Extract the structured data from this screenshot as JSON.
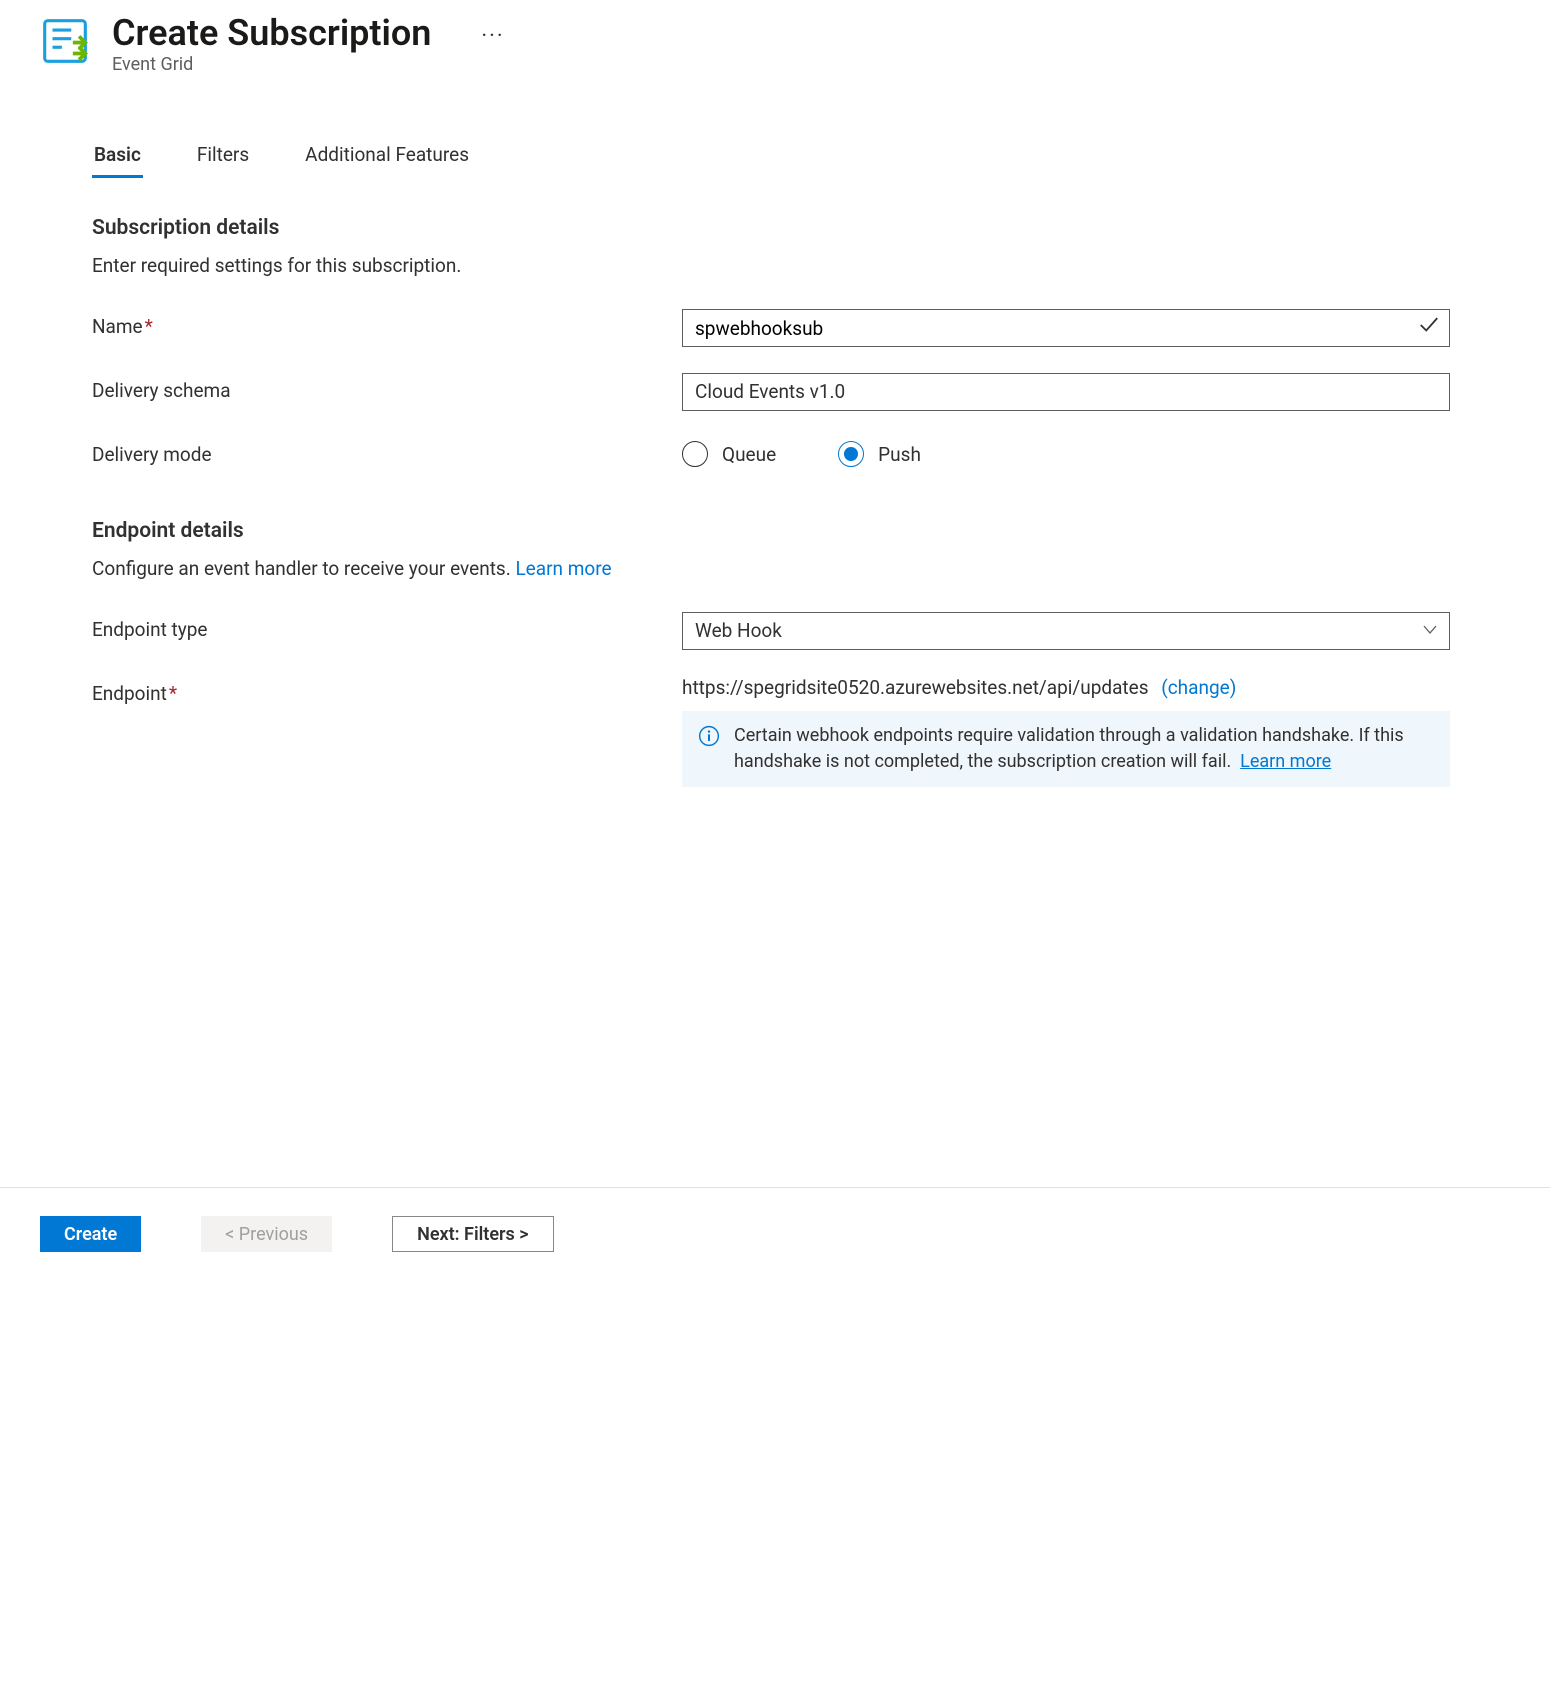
{
  "header": {
    "title": "Create Subscription",
    "subtitle": "Event Grid"
  },
  "tabs": {
    "items": [
      {
        "label": "Basic"
      },
      {
        "label": "Filters"
      },
      {
        "label": "Additional Features"
      }
    ]
  },
  "form": {
    "subscription": {
      "section_title": "Subscription details",
      "section_desc": "Enter required settings for this subscription.",
      "name_label": "Name",
      "name_value": "spwebhooksub",
      "schema_label": "Delivery schema",
      "schema_value": "Cloud Events v1.0",
      "mode_label": "Delivery mode",
      "mode_queue": "Queue",
      "mode_push": "Push"
    },
    "endpoint": {
      "section_title": "Endpoint details",
      "section_desc": "Configure an event handler to receive your events.",
      "learn_more": "Learn more",
      "type_label": "Endpoint type",
      "type_value": "Web Hook",
      "endpoint_label": "Endpoint",
      "endpoint_url": "https://spegridsite0520.azurewebsites.net/api/updates",
      "change_label": "(change)",
      "info_text": "Certain webhook endpoints require validation through a validation handshake. If this handshake is not completed, the subscription creation will fail.",
      "info_learn_more": "Learn more"
    }
  },
  "footer": {
    "create": "Create",
    "previous": "< Previous",
    "next": "Next: Filters >"
  }
}
